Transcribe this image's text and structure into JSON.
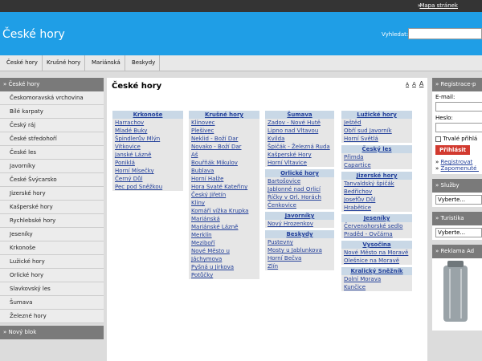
{
  "topbar": {
    "arrow": "»",
    "sitemap": "Mapa stránek"
  },
  "header": {
    "title": "České hory",
    "search_label": "Vyhledat:"
  },
  "nav": {
    "tabs": [
      "České hory",
      "Krušné hory",
      "Mariánská",
      "Beskydy"
    ]
  },
  "sidebar": {
    "heading": "České hory",
    "items": [
      "Českomoravská vrchovina",
      "Bílé karpaty",
      "Český ráj",
      "České středohoří",
      "České les",
      "Javorníky",
      "České Švýcarsko",
      "Jizerské hory",
      "Kašperské hory",
      "Rychlebské hory",
      "Jeseníky",
      "Krkonoše",
      "Lužické hory",
      "Orlické hory",
      "Slavkovský les",
      "Šumava",
      "Železné hory"
    ],
    "heading2": "Nový blok"
  },
  "main": {
    "title": "České hory",
    "font_sizes": [
      "A",
      "A",
      "A"
    ],
    "columns": [
      [
        {
          "head": "Krkonoše",
          "items": [
            "Harrachov",
            "Mladé Buky",
            "Špindlerův Mlýn",
            "Vítkovice",
            "Janské Lázně",
            "Poniklá",
            "Horní Mísečky",
            "Černý Důl",
            "Pec pod Sněžkou"
          ]
        }
      ],
      [
        {
          "head": "Krušné hory",
          "items": [
            "Klínovec",
            "Plešivec",
            "Neklid - Boží Dar",
            "Novako - Boží Dar",
            "Aš",
            "Bouřňák Mikulov",
            "Bublava",
            "Horní Halže",
            "Hora Svaté Kateřiny",
            "Český Jiřetín",
            "Klíny",
            "Komáří vížka Krupka",
            "Mariánská",
            "Mariánské Lázně",
            "Merklín",
            "Meziboří",
            "Nové Město u",
            "Jáchymova",
            "Pyšná u Jirkova",
            "Potůčky"
          ]
        }
      ],
      [
        {
          "head": "Šumava",
          "items": [
            "Zadov - Nové Hutě",
            "Lipno nad Vltavou",
            "Kvilda",
            "Špičák - Železná Ruda",
            "Kašperské Hory",
            "Horní Vltavice"
          ]
        },
        {
          "head": "Orlické hory",
          "items": [
            "Bartošovice",
            "Jablonné nad Orlicí",
            "Říčky v Orl. Horách",
            "Čenkovice"
          ]
        },
        {
          "head": "Javorníky",
          "items": [
            "Nový Hrozenkov"
          ]
        },
        {
          "head": "Beskydy",
          "items": [
            "Pustevny",
            "Mosty u Jablunkova",
            "Horní Bečva",
            "Zlín"
          ]
        }
      ],
      [
        {
          "head": "Lužické hory",
          "items": [
            "Ještěd",
            "Obří sud Javorník",
            "Horní Světlá"
          ]
        },
        {
          "head": "Český les",
          "items": [
            "Přimda",
            "Capartice"
          ]
        },
        {
          "head": "Jizerské hory",
          "items": [
            "Tanvaldský špičák",
            "Bedřichov",
            "Josefův Důl",
            "Hrabětice"
          ]
        },
        {
          "head": "Jeseníky",
          "items": [
            "Červenohorské sedlo",
            "Praděd - Ovčárna"
          ]
        },
        {
          "head": "Vysočina",
          "items": [
            "Nové Město na Moravě",
            "Olešnice na Moravě"
          ]
        },
        {
          "head": "Kralický Sněžník",
          "items": [
            "Dolní Morava",
            "Kunčice"
          ]
        }
      ]
    ]
  },
  "rightbar": {
    "login_head": "Registrace-p",
    "email_label": "E-mail:",
    "password_label": "Heslo:",
    "remember_label": "Trvalé přihlá",
    "login_button": "Přihlásit",
    "register_link": "Registrovat",
    "forgot_link": "Zapomenuté h",
    "services_head": "Služby",
    "services_select": "Vyberte...",
    "tourism_head": "Turistika",
    "tourism_select": "Vyberte...",
    "ads_head": "Reklama Ad"
  }
}
